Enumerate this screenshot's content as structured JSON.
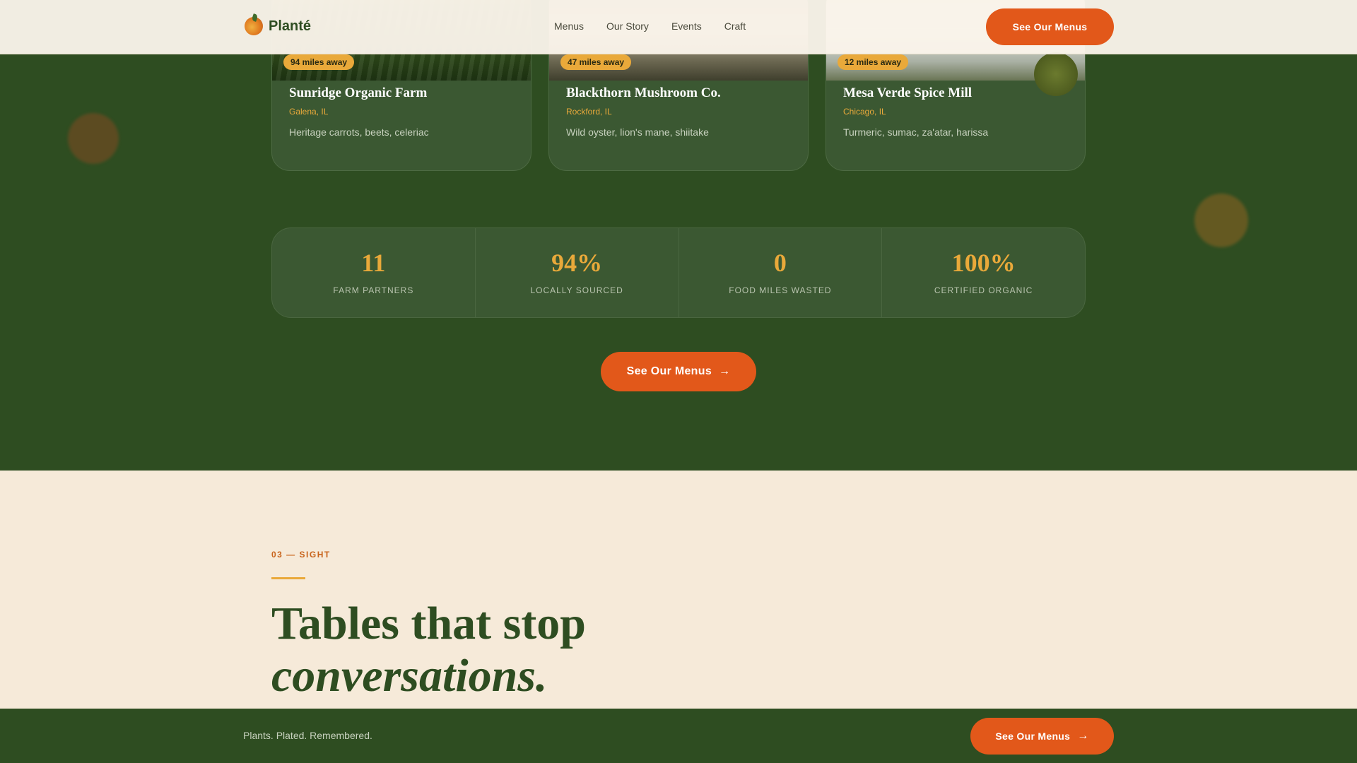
{
  "header": {
    "logo_text": "Planté",
    "nav": [
      "Menus",
      "Our Story",
      "Events",
      "Craft"
    ],
    "cta_label": "See Our Menus"
  },
  "farms": [
    {
      "badge": "94 miles away",
      "name": "Sunridge Organic Farm",
      "location": "Galena, IL",
      "produce": "Heritage carrots, beets, celeriac"
    },
    {
      "badge": "47 miles away",
      "name": "Blackthorn Mushroom Co.",
      "location": "Rockford, IL",
      "produce": "Wild oyster, lion's mane, shiitake"
    },
    {
      "badge": "12 miles away",
      "name": "Mesa Verde Spice Mill",
      "location": "Chicago, IL",
      "produce": "Turmeric, sumac, za'atar, harissa"
    }
  ],
  "stats": [
    {
      "value": "11",
      "label": "FARM PARTNERS"
    },
    {
      "value": "94%",
      "label": "LOCALLY SOURCED"
    },
    {
      "value": "0",
      "label": "FOOD MILES WASTED"
    },
    {
      "value": "100%",
      "label": "CERTIFIED ORGANIC"
    }
  ],
  "mid_cta": {
    "label": "See Our Menus",
    "icon": "arrow-right-icon"
  },
  "section": {
    "eyebrow": "03 — SIGHT",
    "headline_line1": "Tables that stop",
    "headline_line2": "conversations."
  },
  "footer": {
    "tagline": "Plants. Plated. Remembered.",
    "cta_label": "See Our Menus",
    "icon": "arrow-right-icon"
  },
  "colors": {
    "forest": "#2e4d21",
    "card": "#3b5832",
    "amber": "#e9a93a",
    "orange": "#e2581a",
    "cream": "#f6ead9"
  }
}
